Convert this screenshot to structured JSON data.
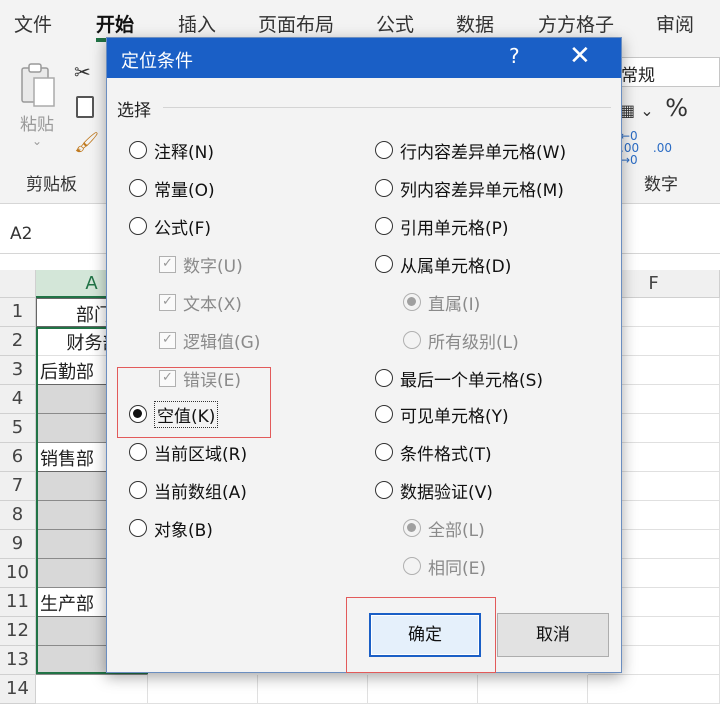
{
  "ribbon": {
    "tabs": [
      "文件",
      "开始",
      "插入",
      "页面布局",
      "公式",
      "数据",
      "方方格子",
      "审阅"
    ],
    "active_tab": "开始",
    "paste_label": "粘贴",
    "group_clipboard": "剪贴板",
    "number_format": "常规",
    "percent_symbol": "%",
    "group_number": "数字"
  },
  "formula_bar": {
    "name_box": "A2"
  },
  "sheet": {
    "column_headers": [
      "A",
      "F"
    ],
    "row_numbers": [
      "1",
      "2",
      "3",
      "4",
      "5",
      "6",
      "7",
      "8",
      "9",
      "10",
      "11",
      "12",
      "13",
      "14"
    ],
    "cells": {
      "a1": "部门",
      "a2": "财务部",
      "a3": "后勤部",
      "a6": "销售部",
      "a11": "生产部"
    }
  },
  "dialog": {
    "title": "定位条件",
    "help": "?",
    "close": "✕",
    "section_label": "选择",
    "left_options": [
      {
        "label": "注释(N)",
        "checked": false,
        "enabled": true
      },
      {
        "label": "常量(O)",
        "checked": false,
        "enabled": true
      },
      {
        "label": "公式(F)",
        "checked": false,
        "enabled": true
      },
      {
        "label": "数字(U)",
        "checked": true,
        "enabled": false
      },
      {
        "label": "文本(X)",
        "checked": true,
        "enabled": false
      },
      {
        "label": "逻辑值(G)",
        "checked": true,
        "enabled": false
      },
      {
        "label": "错误(E)",
        "checked": true,
        "enabled": false
      },
      {
        "label": "空值(K)",
        "checked": true,
        "enabled": true
      },
      {
        "label": "当前区域(R)",
        "checked": false,
        "enabled": true
      },
      {
        "label": "当前数组(A)",
        "checked": false,
        "enabled": true
      },
      {
        "label": "对象(B)",
        "checked": false,
        "enabled": true
      }
    ],
    "right_options": [
      {
        "label": "行内容差异单元格(W)",
        "checked": false,
        "enabled": true
      },
      {
        "label": "列内容差异单元格(M)",
        "checked": false,
        "enabled": true
      },
      {
        "label": "引用单元格(P)",
        "checked": false,
        "enabled": true
      },
      {
        "label": "从属单元格(D)",
        "checked": false,
        "enabled": true
      },
      {
        "label": "直属(I)",
        "checked": true,
        "enabled": false
      },
      {
        "label": "所有级别(L)",
        "checked": false,
        "enabled": false
      },
      {
        "label": "最后一个单元格(S)",
        "checked": false,
        "enabled": true
      },
      {
        "label": "可见单元格(Y)",
        "checked": false,
        "enabled": true
      },
      {
        "label": "条件格式(T)",
        "checked": false,
        "enabled": true
      },
      {
        "label": "数据验证(V)",
        "checked": false,
        "enabled": true
      },
      {
        "label": "全部(L)",
        "checked": true,
        "enabled": false
      },
      {
        "label": "相同(E)",
        "checked": false,
        "enabled": false
      }
    ],
    "ok_label": "确定",
    "cancel_label": "取消"
  },
  "colors": {
    "title_bar": "#1a5fc6",
    "excel_green": "#217346",
    "highlight_red": "#e25a5a"
  }
}
